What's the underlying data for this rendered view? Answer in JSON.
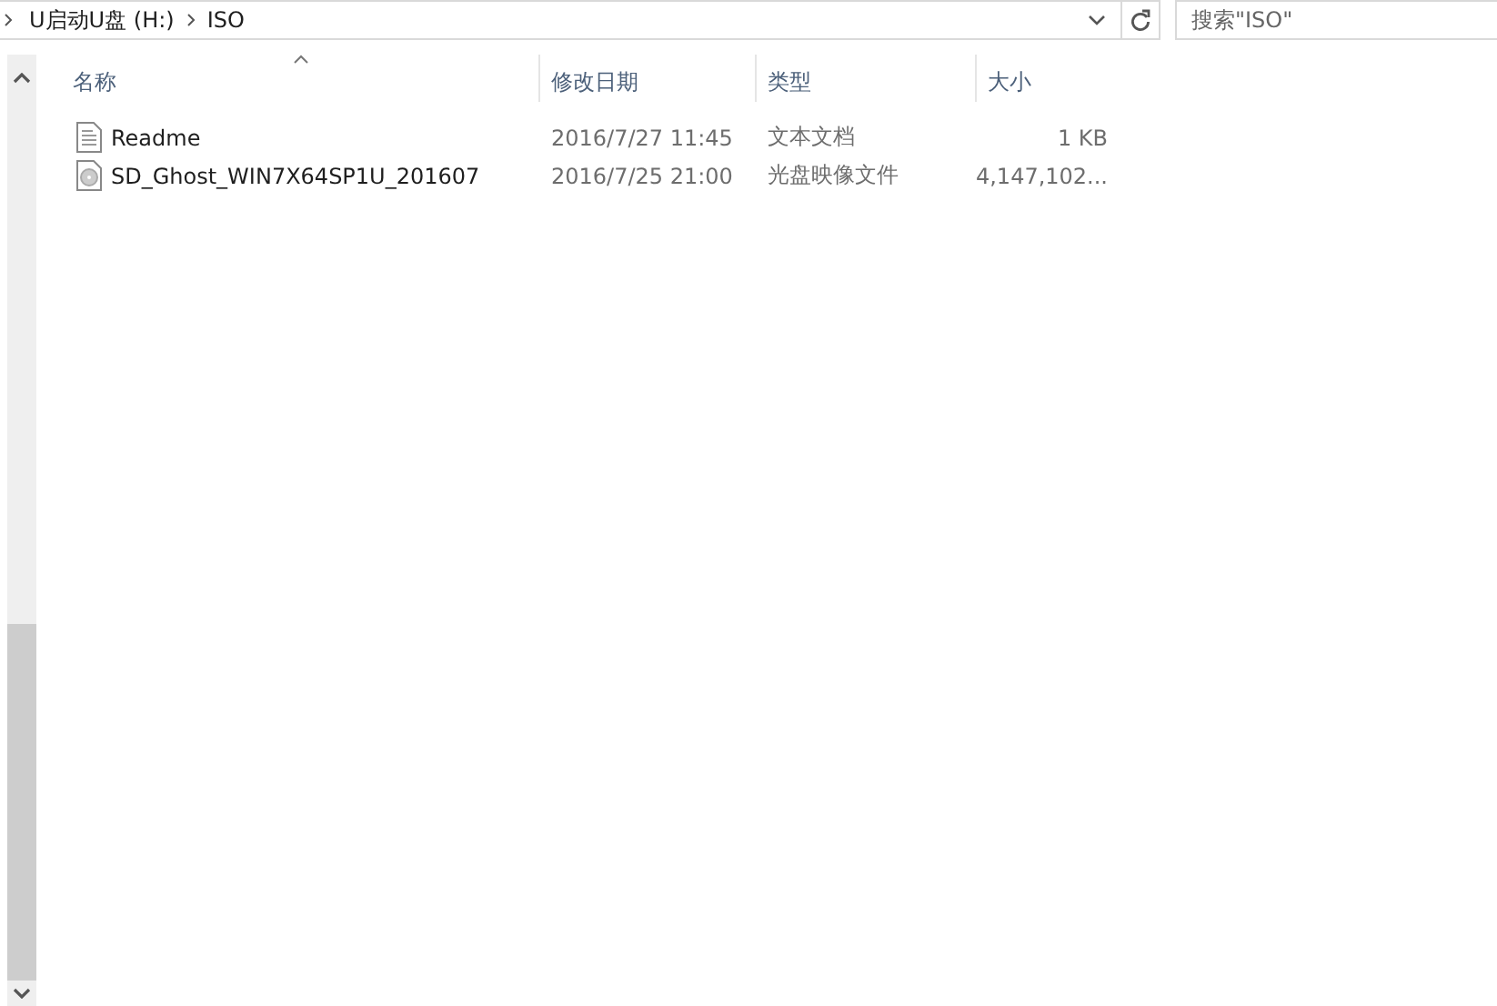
{
  "address_bar": {
    "path": [
      {
        "label": "U启动U盘 (H:)"
      },
      {
        "label": "ISO"
      }
    ]
  },
  "search": {
    "placeholder": "搜索\"ISO\""
  },
  "table": {
    "columns": [
      {
        "label": "名称",
        "sorted": true
      },
      {
        "label": "修改日期",
        "sorted": false
      },
      {
        "label": "类型",
        "sorted": false
      },
      {
        "label": "大小",
        "sorted": false
      }
    ],
    "rows": [
      {
        "kind": "text",
        "name": "Readme",
        "modified": "2016/7/27 11:45",
        "type": "文本文档",
        "size": "1 KB"
      },
      {
        "kind": "disc",
        "name": "SD_Ghost_WIN7X64SP1U_201607",
        "modified": "2016/7/25 21:00",
        "type": "光盘映像文件",
        "size": "4,147,102..."
      }
    ]
  }
}
